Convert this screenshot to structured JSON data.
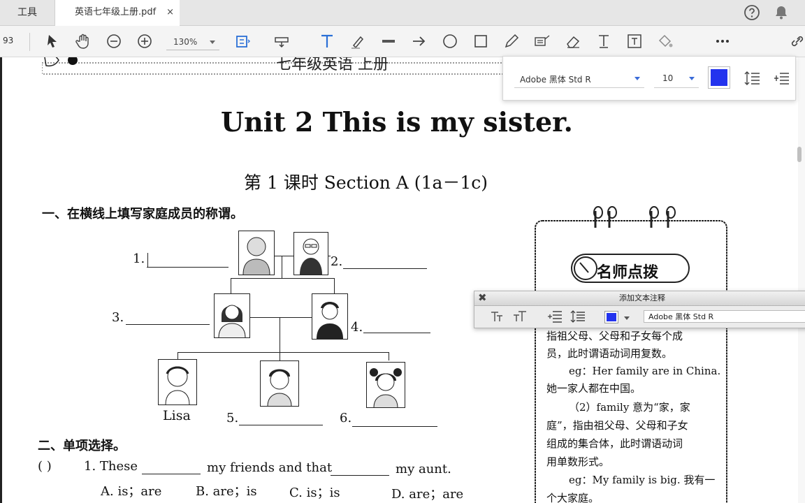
{
  "tabs": {
    "tools_label": "工具",
    "doc_label": "英语七年级上册.pdf",
    "close_glyph": "×"
  },
  "header_icons": [
    "help-icon",
    "notification-bell-icon"
  ],
  "toolbar": {
    "page_number": "93",
    "zoom": "130%",
    "tools": [
      "select-arrow-icon",
      "hand-icon",
      "zoom-out-icon",
      "zoom-in-icon",
      "fit-page-icon",
      "stamp-icon",
      "text-tool-icon",
      "highlighter-icon",
      "strikethrough-icon",
      "arrow-icon",
      "circle-icon",
      "rectangle-icon",
      "pencil-icon",
      "text-callout-icon",
      "eraser-icon",
      "typewriter-icon",
      "text-box-icon",
      "fill-icon",
      "more-icon",
      "link-icon"
    ]
  },
  "font_panel": {
    "font": "Adobe 黑体 Std R",
    "size": "10",
    "color": "#2333ee"
  },
  "annotation_panel": {
    "title": "添加文本注释",
    "font": "Adobe 黑体 Std R",
    "color": "#2333ee",
    "close_glyph": "✖"
  },
  "document": {
    "running_header": "七年级英语 上册",
    "unit_title": "Unit 2    This is my sister.",
    "lesson_title": "第 1 课时    Section A (1a－1c)",
    "section1_heading": "一、在横线上填写家庭成员的称谓。",
    "family_tree": {
      "blanks": [
        "1.",
        "2.",
        "3.",
        "4.",
        "5.",
        "6."
      ],
      "child_name": "Lisa"
    },
    "section2_heading": "二、单项选择。",
    "question1": {
      "paren": "(        )",
      "number": "1. These",
      "middle": "my friends and that",
      "end": "my aunt.",
      "options": [
        "A. is；are",
        "B. are；is",
        "C. is；is",
        "D. are；are"
      ]
    },
    "tips": {
      "badge": "名师点拨",
      "lines": [
        "指祖父母、父母和子女每个成",
        "员，此时谓语动词用复数。",
        "eg：Her family are in China.",
        "她一家人都在中国。",
        "（2）family 意为“家，家",
        "庭”，指由祖父母、父母和子女",
        "组成的集合体，此时谓语动词",
        "用单数形式。",
        "eg：My family is big. 我有一",
        "个大家庭。"
      ]
    }
  }
}
